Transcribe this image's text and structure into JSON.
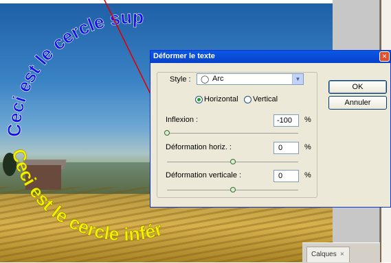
{
  "curved_texts": {
    "top_arc": "Ceci est le cercle sup",
    "bottom_arc": "Ceci est le cercle infér"
  },
  "dialog": {
    "title": "Déformer le texte",
    "close_icon": "close-icon",
    "style_label": "Style :",
    "style_value": "Arc",
    "style_icon": "arc-warp-icon",
    "orientation_horizontal": "Horizontal",
    "orientation_vertical": "Vertical",
    "orientation_selected": "Horizontal",
    "inflexion_label": "Inflexion :",
    "inflexion_value": "-100",
    "deform_h_label": "Déformation horiz. :",
    "deform_h_value": "0",
    "deform_v_label": "Déformation verticale :",
    "deform_v_value": "0",
    "percent": "%",
    "ok_label": "OK",
    "cancel_label": "Annuler",
    "sliders": {
      "inflexion_percent": -100,
      "deform_h_percent": 0,
      "deform_v_percent": 0
    }
  },
  "layers_panel": {
    "tab_label": "Calques",
    "tab_close": "×"
  },
  "colors": {
    "top_text": "#1414e6",
    "bottom_text": "#f2f200",
    "arrow": "#e00000",
    "titlebar": "#0a58e6"
  }
}
